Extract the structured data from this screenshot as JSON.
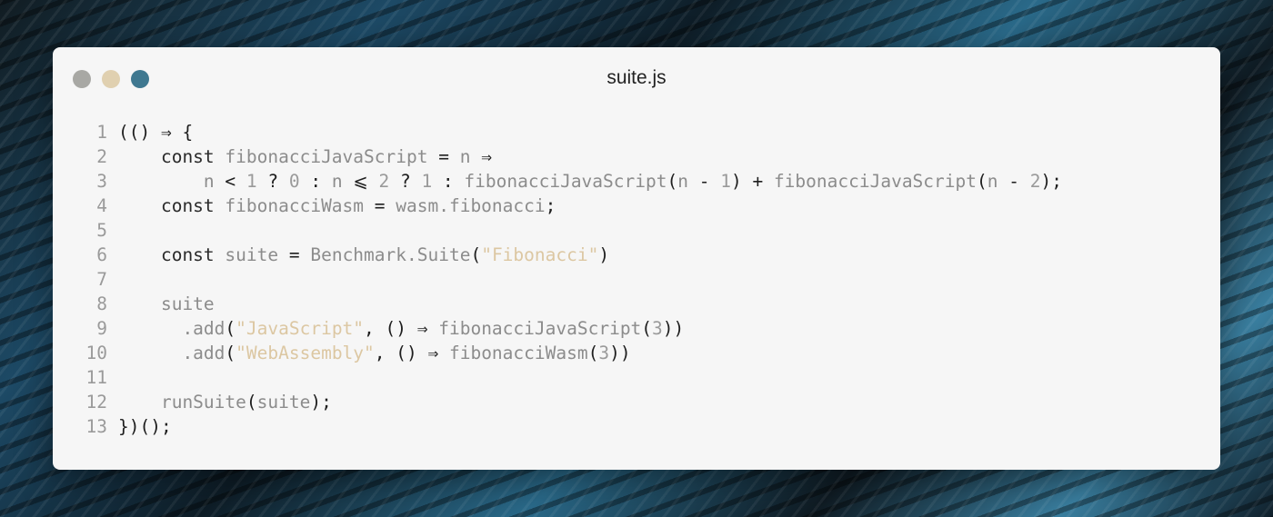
{
  "window": {
    "title": "suite.js",
    "controls": {
      "close_color": "#a8a8a4",
      "minimize_color": "#e0d0b0",
      "maximize_color": "#3f7890"
    }
  },
  "colors": {
    "punctuation": "#1e1e1e",
    "keyword": "#2a2a2a",
    "identifier": "#8c8c8c",
    "number": "#9a9a9a",
    "string": "#dcc7a2",
    "line_number": "#9a9a9a"
  },
  "code": {
    "lines": [
      {
        "num": "1",
        "tokens": [
          {
            "t": "p",
            "v": "(() ⇒ {"
          }
        ]
      },
      {
        "num": "2",
        "tokens": [
          {
            "t": "k",
            "v": "    const "
          },
          {
            "t": "f",
            "v": "fibonacciJavaScript"
          },
          {
            "t": "p",
            "v": " = "
          },
          {
            "t": "f",
            "v": "n"
          },
          {
            "t": "p",
            "v": " ⇒"
          }
        ]
      },
      {
        "num": "3",
        "tokens": [
          {
            "t": "p",
            "v": "        "
          },
          {
            "t": "f",
            "v": "n"
          },
          {
            "t": "p",
            "v": " < "
          },
          {
            "t": "n",
            "v": "1"
          },
          {
            "t": "p",
            "v": " ? "
          },
          {
            "t": "n",
            "v": "0"
          },
          {
            "t": "p",
            "v": " : "
          },
          {
            "t": "f",
            "v": "n"
          },
          {
            "t": "p",
            "v": " ⩽ "
          },
          {
            "t": "n",
            "v": "2"
          },
          {
            "t": "p",
            "v": " ? "
          },
          {
            "t": "n",
            "v": "1"
          },
          {
            "t": "p",
            "v": " : "
          },
          {
            "t": "f",
            "v": "fibonacciJavaScript"
          },
          {
            "t": "p",
            "v": "("
          },
          {
            "t": "f",
            "v": "n"
          },
          {
            "t": "p",
            "v": " - "
          },
          {
            "t": "n",
            "v": "1"
          },
          {
            "t": "p",
            "v": ") + "
          },
          {
            "t": "f",
            "v": "fibonacciJavaScript"
          },
          {
            "t": "p",
            "v": "("
          },
          {
            "t": "f",
            "v": "n"
          },
          {
            "t": "p",
            "v": " - "
          },
          {
            "t": "n",
            "v": "2"
          },
          {
            "t": "p",
            "v": ");"
          }
        ]
      },
      {
        "num": "4",
        "tokens": [
          {
            "t": "k",
            "v": "    const "
          },
          {
            "t": "f",
            "v": "fibonacciWasm"
          },
          {
            "t": "p",
            "v": " = "
          },
          {
            "t": "f",
            "v": "wasm.fibonacci"
          },
          {
            "t": "p",
            "v": ";"
          }
        ]
      },
      {
        "num": "5",
        "tokens": []
      },
      {
        "num": "6",
        "tokens": [
          {
            "t": "k",
            "v": "    const "
          },
          {
            "t": "f",
            "v": "suite"
          },
          {
            "t": "p",
            "v": " = "
          },
          {
            "t": "f",
            "v": "Benchmark.Suite"
          },
          {
            "t": "p",
            "v": "("
          },
          {
            "t": "s",
            "v": "\"Fibonacci\""
          },
          {
            "t": "p",
            "v": ")"
          }
        ]
      },
      {
        "num": "7",
        "tokens": []
      },
      {
        "num": "8",
        "tokens": [
          {
            "t": "f",
            "v": "    suite"
          }
        ]
      },
      {
        "num": "9",
        "tokens": [
          {
            "t": "f",
            "v": "      .add"
          },
          {
            "t": "p",
            "v": "("
          },
          {
            "t": "s",
            "v": "\"JavaScript\""
          },
          {
            "t": "p",
            "v": ", () ⇒ "
          },
          {
            "t": "f",
            "v": "fibonacciJavaScript"
          },
          {
            "t": "p",
            "v": "("
          },
          {
            "t": "n",
            "v": "3"
          },
          {
            "t": "p",
            "v": "))"
          }
        ]
      },
      {
        "num": "10",
        "tokens": [
          {
            "t": "f",
            "v": "      .add"
          },
          {
            "t": "p",
            "v": "("
          },
          {
            "t": "s",
            "v": "\"WebAssembly\""
          },
          {
            "t": "p",
            "v": ", () ⇒ "
          },
          {
            "t": "f",
            "v": "fibonacciWasm"
          },
          {
            "t": "p",
            "v": "("
          },
          {
            "t": "n",
            "v": "3"
          },
          {
            "t": "p",
            "v": "))"
          }
        ]
      },
      {
        "num": "11",
        "tokens": []
      },
      {
        "num": "12",
        "tokens": [
          {
            "t": "f",
            "v": "    runSuite"
          },
          {
            "t": "p",
            "v": "("
          },
          {
            "t": "f",
            "v": "suite"
          },
          {
            "t": "p",
            "v": ");"
          }
        ]
      },
      {
        "num": "13",
        "tokens": [
          {
            "t": "p",
            "v": "})();"
          }
        ]
      }
    ]
  }
}
